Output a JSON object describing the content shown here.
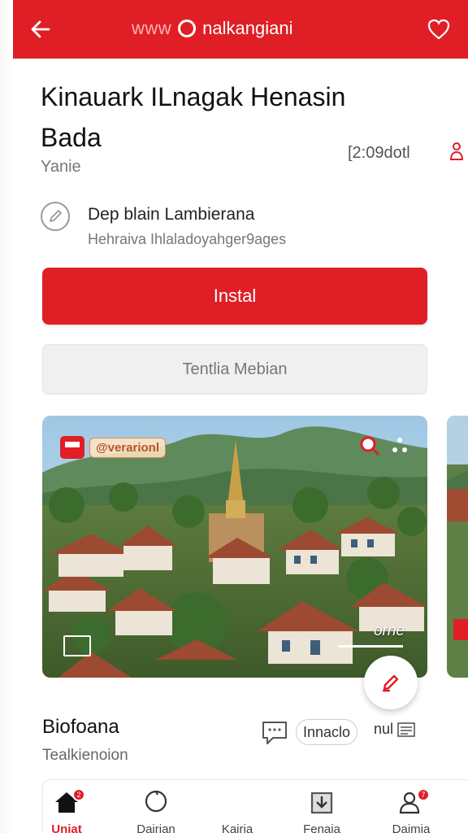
{
  "topbar": {
    "back_icon": "arrow-left-icon",
    "url_prefix": "www",
    "brand": "nalkangiani",
    "favorite_icon": "heart-icon",
    "color": "#e01e26"
  },
  "app": {
    "title": "Kinauark ILnagak Henasin Bada",
    "subtitle": "Yanie",
    "time": "[2:09dotl",
    "share_icon": "share-icon"
  },
  "developer": {
    "icon": "pencil-icon",
    "name": "Dep blain Lambierana",
    "meta": "Hehraiva Ihlaladoyahger9ages"
  },
  "actions": {
    "install_label": "Instal",
    "secondary_label": "Tentlia Mebian"
  },
  "screenshot": {
    "badge_label": "@verarionl",
    "caption": "orne"
  },
  "info": {
    "title": "Biofoana",
    "subtitle": "Tealkienoion",
    "pill_label": "Innaclo",
    "count_label": "nul"
  },
  "nav": {
    "items": [
      {
        "label": "Uniat",
        "icon": "home-icon",
        "badge": "2"
      },
      {
        "label": "Dairian",
        "icon": "heart-outline-icon"
      },
      {
        "label": "Kairia",
        "icon": "blank"
      },
      {
        "label": "Fenaia",
        "icon": "download-icon"
      },
      {
        "label": "Daimia",
        "icon": "profile-icon",
        "badge": "7"
      }
    ]
  }
}
